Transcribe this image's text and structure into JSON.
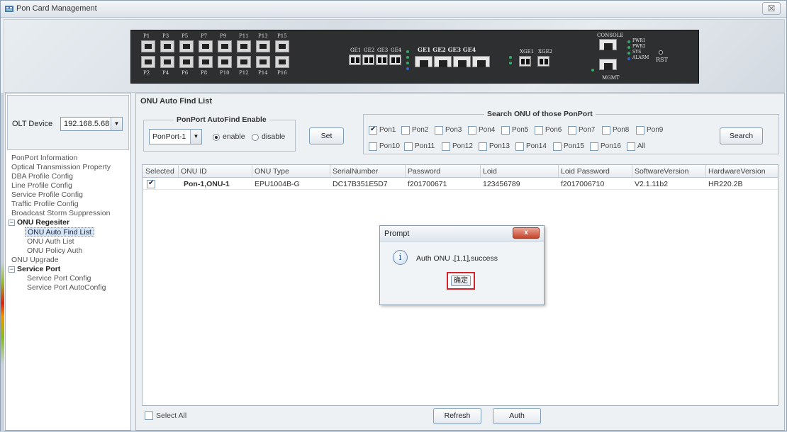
{
  "window": {
    "title": "Pon Card Management",
    "close_glyph": "☒"
  },
  "device": {
    "pon_top": [
      "P1",
      "P3",
      "P5",
      "P7",
      "P9",
      "P11",
      "P13",
      "P15"
    ],
    "pon_bottom": [
      "P2",
      "P4",
      "P6",
      "P8",
      "P10",
      "P12",
      "P14",
      "P16"
    ],
    "ge_sfp_labels": [
      "GE1",
      "GE2",
      "GE3",
      "GE4"
    ],
    "ge_rj_labels": "GE1 GE2 GE3 GE4",
    "xge_labels": [
      "XGE1",
      "XGE2"
    ],
    "console_label": "CONSOLE",
    "mgmt_label": "MGMT",
    "rst_label": "RST",
    "status_leds": [
      "PWR1",
      "PWR2",
      "SYS",
      "ALARM"
    ]
  },
  "sidebar": {
    "olt_label": "OLT Device",
    "olt_value": "192.168.5.68",
    "items": [
      {
        "label": "PonPort Information"
      },
      {
        "label": "Optical Transmission Property"
      },
      {
        "label": "DBA Profile Config"
      },
      {
        "label": "Line Profile Config"
      },
      {
        "label": "Service Profile Config"
      },
      {
        "label": "Traffic Profile Config"
      },
      {
        "label": "Broadcast Storm Suppression"
      },
      {
        "label": "ONU Regesiter"
      },
      {
        "label": "ONU Auto Find List"
      },
      {
        "label": "ONU Auth List"
      },
      {
        "label": "ONU Policy Auth"
      },
      {
        "label": "ONU Upgrade"
      },
      {
        "label": "Service Port"
      },
      {
        "label": "Service Port Config"
      },
      {
        "label": "Service Port AutoConfig"
      }
    ]
  },
  "main": {
    "title": "ONU Auto Find List",
    "autofind": {
      "group_title": "PonPort AutoFind Enable",
      "port_value": "PonPort-1",
      "enable_label": "enable",
      "disable_label": "disable",
      "set_label": "Set"
    },
    "search": {
      "group_title": "Search ONU of those PonPort",
      "ports": [
        {
          "label": "Pon1",
          "checked": true
        },
        {
          "label": "Pon2",
          "checked": false
        },
        {
          "label": "Pon3",
          "checked": false
        },
        {
          "label": "Pon4",
          "checked": false
        },
        {
          "label": "Pon5",
          "checked": false
        },
        {
          "label": "Pon6",
          "checked": false
        },
        {
          "label": "Pon7",
          "checked": false
        },
        {
          "label": "Pon8",
          "checked": false
        },
        {
          "label": "Pon9",
          "checked": false
        },
        {
          "label": "Pon10",
          "checked": false
        },
        {
          "label": "Pon11",
          "checked": false
        },
        {
          "label": "Pon12",
          "checked": false
        },
        {
          "label": "Pon13",
          "checked": false
        },
        {
          "label": "Pon14",
          "checked": false
        },
        {
          "label": "Pon15",
          "checked": false
        },
        {
          "label": "Pon16",
          "checked": false
        },
        {
          "label": "All",
          "checked": false
        }
      ],
      "search_label": "Search"
    },
    "table": {
      "columns": [
        "Selected",
        "ONU ID",
        "ONU Type",
        "SerialNumber",
        "Password",
        "Loid",
        "Loid Password",
        "SoftwareVersion",
        "HardwareVersion"
      ],
      "rows": [
        [
          "",
          "Pon-1,ONU-1",
          "EPU1004B-G",
          "DC17B351E5D7",
          "f201700671",
          "123456789",
          "f2017006710",
          "V2.1.11b2",
          "HR220.2B"
        ]
      ]
    },
    "select_all_label": "Select All",
    "refresh_label": "Refresh",
    "auth_label": "Auth"
  },
  "dialog": {
    "title": "Prompt",
    "close_glyph": "x",
    "info_glyph": "i",
    "message": "Auth ONU .[1,1],success",
    "ok_label": "确定"
  }
}
